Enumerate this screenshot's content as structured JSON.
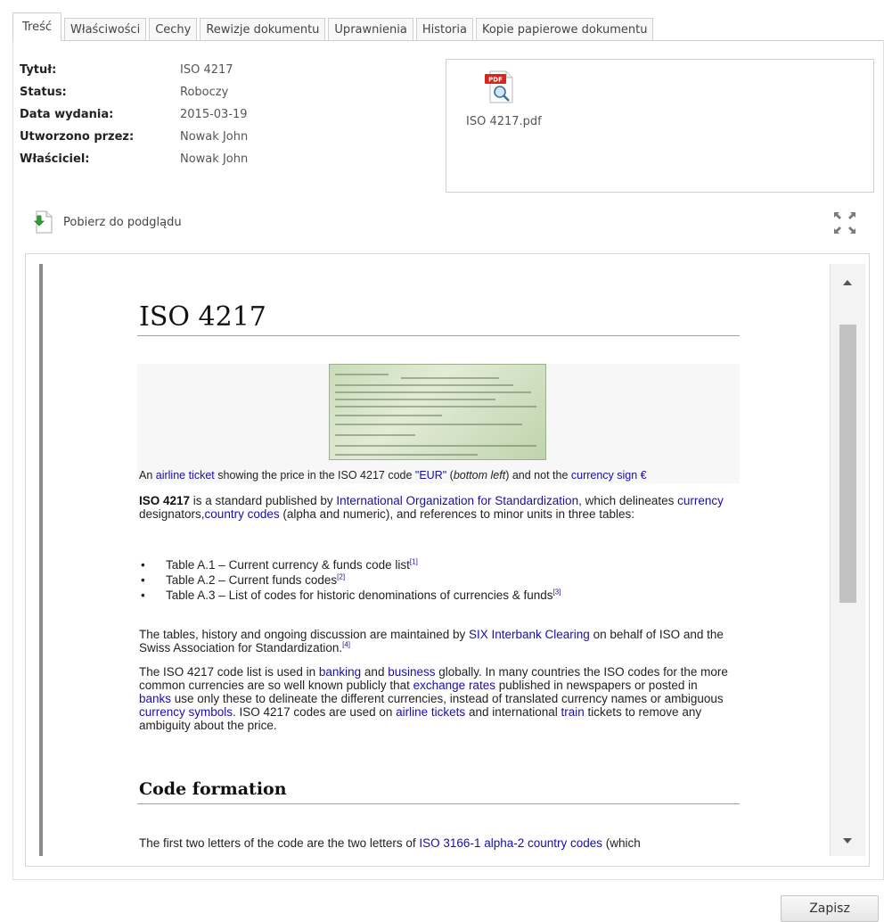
{
  "tabs": [
    {
      "label": "Treść",
      "active": true
    },
    {
      "label": "Właściwości",
      "active": false
    },
    {
      "label": "Cechy",
      "active": false
    },
    {
      "label": "Rewizje dokumentu",
      "active": false
    },
    {
      "label": "Uprawnienia",
      "active": false
    },
    {
      "label": "Historia",
      "active": false
    },
    {
      "label": "Kopie papierowe dokumentu",
      "active": false
    }
  ],
  "meta": [
    {
      "label": "Tytuł:",
      "value": "ISO 4217"
    },
    {
      "label": "Status:",
      "value": "Roboczy"
    },
    {
      "label": "Data wydania:",
      "value": "2015-03-19"
    },
    {
      "label": "Utworzono przez:",
      "value": "Nowak John"
    },
    {
      "label": "Właściciel:",
      "value": "Nowak John"
    }
  ],
  "attachment": {
    "icon_badge": "PDF",
    "filename": "ISO 4217.pdf"
  },
  "preview": {
    "download_label": "Pobierz do podglądu"
  },
  "doc": {
    "title": "ISO 4217",
    "caption": {
      "t1": "An ",
      "l1": "airline ticket",
      "t2": " showing the price in the ISO 4217 code ",
      "l2": "\"EUR\"",
      "t3": " (",
      "i1": "bottom left",
      "t4": ") and not the ",
      "l3": "currency sign €"
    },
    "p1": {
      "b1": "ISO 4217",
      "t1": " is a standard published by ",
      "l1": "International Organization for Standardization",
      "t2": ", which delineates ",
      "l2": "currency",
      "t3": " designators,",
      "l3": "country codes",
      "t4": " (alpha and numeric), and references to minor units in three tables:"
    },
    "bullets": [
      {
        "b": "Table A.1 –",
        "t": " Current currency & funds code list",
        "ref": "[1]"
      },
      {
        "b": "Table A.2 –",
        "t": " Current funds codes",
        "ref": "[2]"
      },
      {
        "b": "Table A.3 –",
        "t": " List of codes for historic denominations of currencies & funds",
        "ref": "[3]"
      }
    ],
    "p2": {
      "t1": "The tables, history and ongoing discussion are maintained by ",
      "l1": "SIX Interbank Clearing",
      "t2": " on behalf of ISO and the Swiss Association for Standardization.",
      "ref": "[4]"
    },
    "p3": {
      "t1": "The ISO 4217 code list is used in ",
      "l1": "banking",
      "t2": " and ",
      "l2": "business",
      "t3": " globally. In many countries the ISO codes for the more common currencies are so well known publicly that ",
      "l3": "exchange rates",
      "t4": " published in newspapers or posted in ",
      "l4": "banks",
      "t5": " use only these to delineate the different currencies, instead of translated currency names or ambiguous ",
      "l5": "currency symbols",
      "t6": ". ISO 4217 codes are used on ",
      "l6": "airline tickets",
      "t7": " and international ",
      "l7": "train",
      "t8": " tickets to remove any ambiguity about the price."
    },
    "h2": "Code formation",
    "p4": {
      "t1": "The first two letters of the code are the two letters of ",
      "l1": "ISO 3166-1 alpha-2 country codes",
      "t2": " (which"
    }
  },
  "save_label": "Zapisz",
  "colors": {
    "link": "#1a0dab",
    "border": "#cfcfcf",
    "pdf_red": "#d9261c"
  }
}
